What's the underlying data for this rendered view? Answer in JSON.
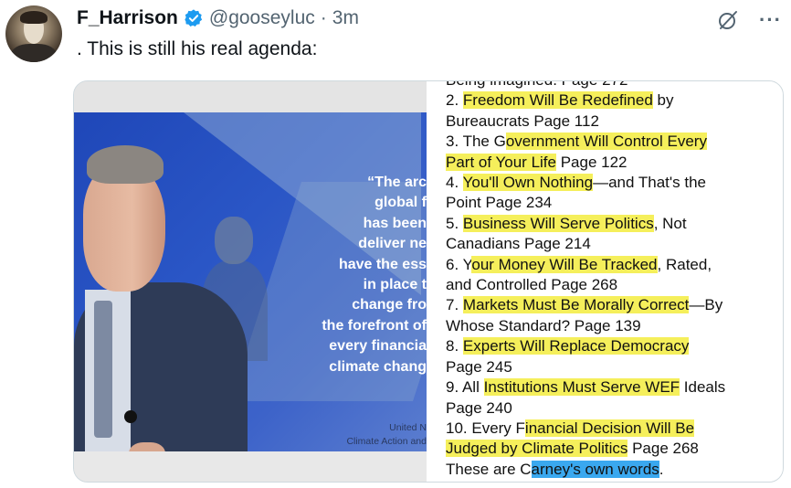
{
  "post": {
    "author_name": "F_Harrison",
    "handle": "@gooseyluc",
    "separator": "·",
    "time": "3m",
    "text": ". This is still his real agenda:",
    "more_label": "···"
  },
  "icons": {
    "verified": "verified-badge-icon",
    "grok": "grok-icon",
    "more": "more-icon"
  },
  "colors": {
    "verified_blue": "#1d9bf0",
    "highlight_yellow": "#f5ef5b",
    "highlight_blue": "#3aa8ef",
    "image_blue": "#2a56c6"
  },
  "media": {
    "quote_lines": [
      "“The arc",
      "global f",
      "has been",
      "deliver ne",
      "have the ess",
      "in place t",
      "change fro",
      "the forefront of",
      "every financia",
      "climate chang"
    ],
    "caption_lines": [
      "United N",
      "Climate Action and"
    ],
    "list_lines": [
      [
        {
          "t": "Being imagined. Page 272",
          "h": ""
        }
      ],
      [
        {
          "t": "2. ",
          "h": ""
        },
        {
          "t": "Freedom Will Be Redefined",
          "h": "y"
        },
        {
          "t": " by",
          "h": ""
        }
      ],
      [
        {
          "t": "Bureaucrats Page 112",
          "h": ""
        }
      ],
      [
        {
          "t": "3. The G",
          "h": ""
        },
        {
          "t": "overnment Will Control Every",
          "h": "y"
        }
      ],
      [
        {
          "t": "Part of Your Life",
          "h": "y"
        },
        {
          "t": " Page 122",
          "h": ""
        }
      ],
      [
        {
          "t": "4. ",
          "h": ""
        },
        {
          "t": "You'll Own Nothing",
          "h": "y"
        },
        {
          "t": "—and That's the",
          "h": ""
        }
      ],
      [
        {
          "t": "Point Page 234",
          "h": ""
        }
      ],
      [
        {
          "t": "5. ",
          "h": ""
        },
        {
          "t": "Business Will Serve Politics",
          "h": "y"
        },
        {
          "t": ", Not",
          "h": ""
        }
      ],
      [
        {
          "t": "Canadians Page 214",
          "h": ""
        }
      ],
      [
        {
          "t": "6. Y",
          "h": ""
        },
        {
          "t": "our Money Will Be Tracked",
          "h": "y"
        },
        {
          "t": ", Rated,",
          "h": ""
        }
      ],
      [
        {
          "t": "and Controlled Page 268",
          "h": ""
        }
      ],
      [
        {
          "t": "7. ",
          "h": ""
        },
        {
          "t": "Markets Must Be Morally Correct",
          "h": "y"
        },
        {
          "t": "—By",
          "h": ""
        }
      ],
      [
        {
          "t": "Whose Standard? Page 139",
          "h": ""
        }
      ],
      [
        {
          "t": "8. ",
          "h": ""
        },
        {
          "t": "Experts Will Replace Democracy",
          "h": "y"
        }
      ],
      [
        {
          "t": "Page 245",
          "h": ""
        }
      ],
      [
        {
          "t": "9. All ",
          "h": ""
        },
        {
          "t": "Institutions Must Serve WEF",
          "h": "y"
        },
        {
          "t": " Ideals",
          "h": ""
        }
      ],
      [
        {
          "t": "Page 240",
          "h": ""
        }
      ],
      [
        {
          "t": "10. Every F",
          "h": ""
        },
        {
          "t": "inancial Decision Will Be",
          "h": "y"
        }
      ],
      [
        {
          "t": "Judged by Climate Politics",
          "h": "y"
        },
        {
          "t": " Page 268",
          "h": ""
        }
      ],
      [
        {
          "t": "These are C",
          "h": ""
        },
        {
          "t": "arney's own words",
          "h": "b"
        },
        {
          "t": ".",
          "h": ""
        }
      ]
    ]
  }
}
